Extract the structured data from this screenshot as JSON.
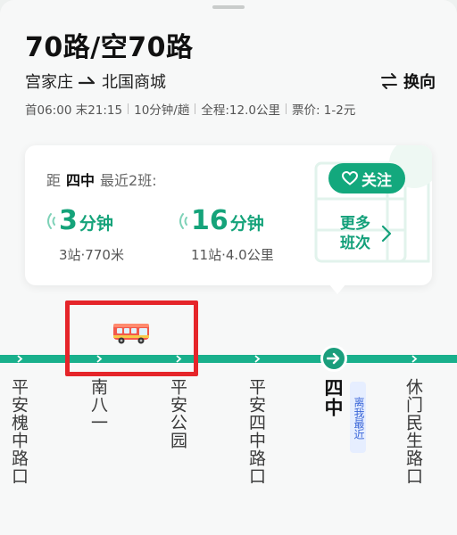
{
  "route": {
    "title": "70路/空70路",
    "from": "宫家庄",
    "to": "北国商城",
    "switch_label": "换向",
    "info": [
      "首06:00 末21:15",
      "10分钟/趟",
      "全程:12.0公里",
      "票价: 1-2元"
    ]
  },
  "eta_card": {
    "prefix": "距",
    "stop": "四中",
    "suffix": "最近2班:",
    "follow_label": "关注",
    "buses": [
      {
        "minutes": "3",
        "unit": "分钟",
        "detail": "3站·770米"
      },
      {
        "minutes": "16",
        "unit": "分钟",
        "detail": "11站·4.0公里"
      }
    ],
    "more_label": "更多班次"
  },
  "stations": [
    "平安槐中路口",
    "南八一",
    "平安公园",
    "平安四中路口",
    "四中",
    "休门民生路口"
  ],
  "current_stop_tag": "离我最近",
  "colors": {
    "accent_green": "#13a87d",
    "route_line": "#19b08c",
    "highlight_red": "#e5252a",
    "tag_blue": "#3a66d8"
  },
  "icons": {
    "direction": "arrow-right-icon",
    "switch": "swap-arrows-icon",
    "follow": "heart-icon",
    "eta": "signal-waves-icon",
    "more": "chevron-right-icon",
    "bus": "bus-icon",
    "current": "arrow-circle-icon"
  }
}
